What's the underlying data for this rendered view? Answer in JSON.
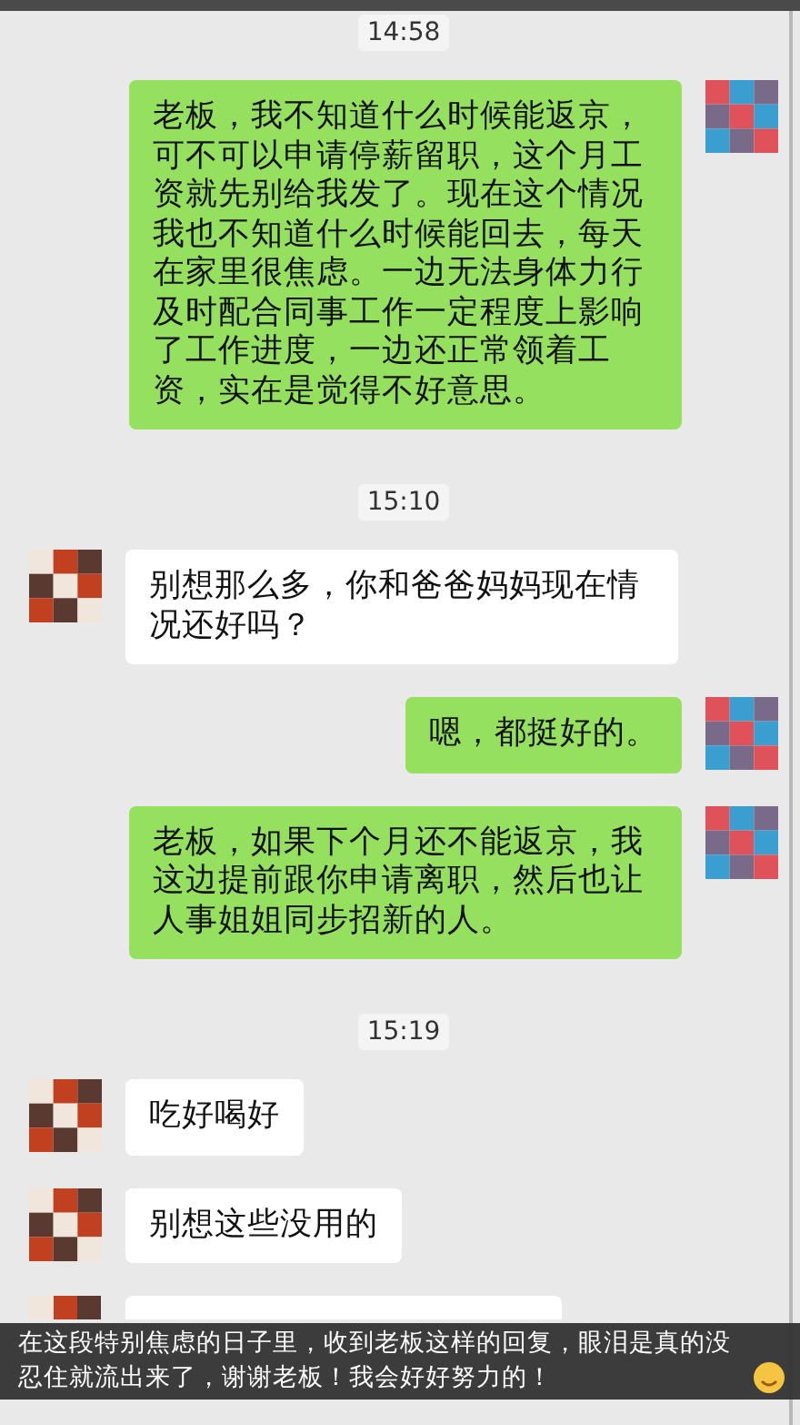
{
  "messages": [
    {
      "kind": "time",
      "text": "14:58"
    },
    {
      "kind": "sent",
      "text": "老板，我不知道什么时候能返京，可不可以申请停薪留职，这个月工资就先别给我发了。现在这个情况我也不知道什么时候能回去，每天在家里很焦虑。一边无法身体力行及时配合同事工作一定程度上影响了工作进度，一边还正常领着工资，实在是觉得不好意思。"
    },
    {
      "kind": "time",
      "text": "15:10"
    },
    {
      "kind": "received",
      "text": "别想那么多，你和爸爸妈妈现在情况还好吗？"
    },
    {
      "kind": "sent",
      "text": "嗯，都挺好的。"
    },
    {
      "kind": "sent",
      "text": "老板，如果下个月还不能返京，我这边提前跟你申请离职，然后也让人事姐姐同步招新的人。"
    },
    {
      "kind": "time",
      "text": "15:19"
    },
    {
      "kind": "received",
      "text": "吃好喝好"
    },
    {
      "kind": "received",
      "text": "别想这些没用的"
    },
    {
      "kind": "received"
    }
  ],
  "caption": {
    "text": "在这段特别焦虑的日子里，收到老板这样的回复，眼泪是真的没忍住就流出来了，谢谢老板！我会好好努力的！"
  }
}
